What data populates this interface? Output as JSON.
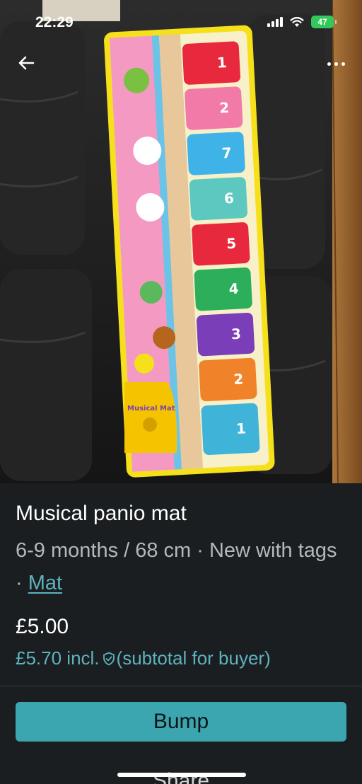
{
  "status_bar": {
    "time": "22:29",
    "battery": "47"
  },
  "photo": {
    "mat_label": "Musical Mat"
  },
  "listing": {
    "title": "Musical panio mat",
    "meta_text": "6-9 months / 68 cm · New with tags · ",
    "category_link": "Mat",
    "price": "£5.00",
    "price_incl": "£5.70 incl.",
    "price_note": "(subtotal for buyer)"
  },
  "actions": {
    "bump_label": "Bump",
    "share_label": "Share"
  },
  "icons": {
    "back": "arrow-left-icon",
    "more": "more-dots-icon",
    "shield": "shield-check-icon"
  },
  "colors": {
    "accent": "#3ba6b0",
    "link": "#5eb3bf",
    "background": "#1a1e20"
  }
}
